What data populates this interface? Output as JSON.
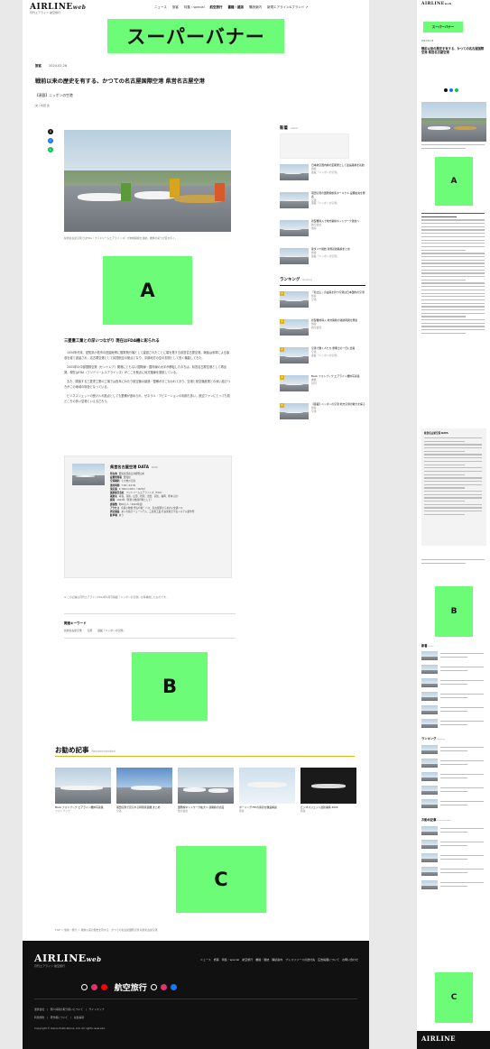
{
  "header": {
    "logo": "AIRLINE",
    "logo_web": "web",
    "logo_sub": "月刊エアライン 航空旅行",
    "nav": [
      "ニュース",
      "旅客",
      "特集・special",
      "航空旅行",
      "書籍・雑誌",
      "購読案内",
      "新規エアライン&ブランド ↗"
    ],
    "nav_emphasis": [
      "航空旅行",
      "書籍・雑誌"
    ]
  },
  "super_banner": "スーパーバナー",
  "article": {
    "category": "旅客",
    "date": "2024.02.26",
    "title": "戦前以来の歴史を有する、かつての名古屋国際空港 県営名古屋空港",
    "subtitle": "【連載】ニッポンの空港",
    "author": "文 / 内田 泰",
    "caption": "県営名古屋空港ではFDA（フジドリームエアラインズ）が地域路線を運航。機体の彩りが目を引く。",
    "heading": "三菱重工業との深いつながり 現在はFDA機に彩られる",
    "paragraphs": [
      "1930年代末、愛知県小牧市の田園地帯に陸軍飛行場として建設されたことに端を発する県営名古屋空港。戦後は米軍による接収を経て返還され、名古屋空港として民間航空の拠点となり、中部地方の空の玄関として長く機能してきた。",
      "2005年の中部国際空港（セントレア）開港にともない国際線・国内線の大半が移転したのちは、県営名古屋空港として再出発。現在はFDA（フジドリームエアラインズ）がここを拠点に地方路線を運航している。",
      "また、隣接する三菱重工業の工場では長年にわたり航空機の製造・整備がおこなわれており、空港と航空機産業との深い結びつきがこの地域の特色となっている。",
      "ビジネスジェットの受け入れ拠点としても整備が進められ、ゼネラル・アビエーションの利用も多い。航空ファンにとっても見どころの多い空港といえるだろう。"
    ],
    "note": "※ この記事は月刊エアライン2024年4月号掲載「ニッポンの空港」を再構成したものです。",
    "keywords_label": "関連キーワード",
    "keywords": [
      "県営名古屋空港",
      "空港",
      "連載「ニッポンの空港」"
    ]
  },
  "share": {
    "x": "X",
    "facebook": "f",
    "line": "L"
  },
  "databox": {
    "title": "県営名古屋空港 DATA",
    "title_en": "DATA",
    "rows": [
      {
        "k": "所在地",
        "v": "愛知県西春日井郡豊山町"
      },
      {
        "k": "設置管理者",
        "v": "愛知県"
      },
      {
        "k": "空港種別",
        "v": "その他の空港"
      },
      {
        "k": "運用時間",
        "v": "7:00〜22:00"
      },
      {
        "k": "滑走路",
        "v": "2,740m×45m（16/34）"
      },
      {
        "k": "就航航空会社",
        "v": "フジドリームエアラインズ（FDA）"
      },
      {
        "k": "就航先",
        "v": "青森、花巻、山形、新潟、出雲、高知、福岡、熊本 ほか"
      },
      {
        "k": "開港",
        "v": "1944年（陸軍小牧飛行場として）"
      },
      {
        "k": "旅客数",
        "v": "約60万人（2022年度）"
      },
      {
        "k": "アクセス",
        "v": "名鉄小牧線 豊山町駅・バス、名古屋駅からあおい交通バス"
      },
      {
        "k": "周辺施設",
        "v": "あいち航空ミュージアム、三菱重工業 名古屋航空宇宙システム製作所"
      },
      {
        "k": "駐車場",
        "v": "あり"
      }
    ]
  },
  "ads": {
    "a": "A",
    "b": "B",
    "c": "C"
  },
  "sidebar": {
    "new_title": "新着",
    "new_en": "Latest",
    "new_items": [
      {
        "title": "日本航空国内線の定期便として最長路線を就航",
        "meta": "旅客",
        "meta2": "連載「ニッポンの空港」"
      },
      {
        "title": "羽田空港の国際線旅客ターミナル 設備拡充を発表",
        "meta": "空港",
        "meta2": "連載「ニッポンの空港」"
      },
      {
        "title": "新型機導入で地方路線ネットワーク強化へ",
        "meta": "航空会社",
        "meta2": "旅客"
      },
      {
        "title": "夏ダイヤ開始 新規就航路線まとめ",
        "meta": "旅客",
        "meta2": "連載「ニッポンの空港」"
      }
    ],
    "ranking_title": "ランキング",
    "ranking_en": "Ranking",
    "ranking_items": [
      {
        "title": "「新之山」の由来を持つ空港は日本国内の空港",
        "meta": "旅客",
        "meta2": "空港"
      },
      {
        "title": "新型機材導入 地方路線の運航再開を発表",
        "meta": "旅客",
        "meta2": "航空会社"
      },
      {
        "title": "空港で働く人たち 整備士の一日に密着",
        "meta": "空港",
        "meta2": "連載「ニッポンの空港」"
      },
      {
        "title": "Book フォトブック エアライン機体写真集",
        "meta": "書籍",
        "meta2": "新刊"
      },
      {
        "title": "【連載】ニッポンの空港 地方空港の魅力を探る",
        "meta": "旅客",
        "meta2": "空港"
      }
    ]
  },
  "recommended": {
    "title": "お勧め記事",
    "title_en": "Recommended",
    "items": [
      {
        "title": "Book フォトブック エアライン機体写真集",
        "meta": "フォトブック"
      },
      {
        "title": "羽田空港で見られる特別塗装機 まとめ",
        "meta": "空港"
      },
      {
        "title": "国際線ネットワーク拡大へ 新路線の計画",
        "meta": "航空会社"
      },
      {
        "title": "ボーイング787の客室を徹底解説",
        "meta": "旅客"
      },
      {
        "title": "ビジネスジェット最新事情 2024",
        "meta": "特集"
      }
    ]
  },
  "breadcrumb": "TOP ＞ 旅客・旅行 ＞ 戦前以来の歴史を有する、かつての名古屋国際空港 県営名古屋空港",
  "footer": {
    "logo": "AIRLINE",
    "logo_web": "web",
    "logo_sub": "月刊エアライン 航空旅行",
    "links": "ニュース　旅客　特集・special　航空旅行　書籍・雑誌　購読案内　プレスリリースの送付先　広告掲載について　お問い合わせ",
    "brand1": "AIRLINE",
    "brand2": "航空旅行",
    "small1": "運営会社　|　個人情報の取り扱いについて　|　サイトマップ",
    "small2": "利用規約　|　著作権について　|　免責事項",
    "copyright": "Copyright © Ikaros Publications, Ltd. All rights reserved."
  },
  "colors": {
    "ad_green": "#6dfc78",
    "accent_gold": "#e0b31c",
    "footer_bg": "#111111"
  }
}
